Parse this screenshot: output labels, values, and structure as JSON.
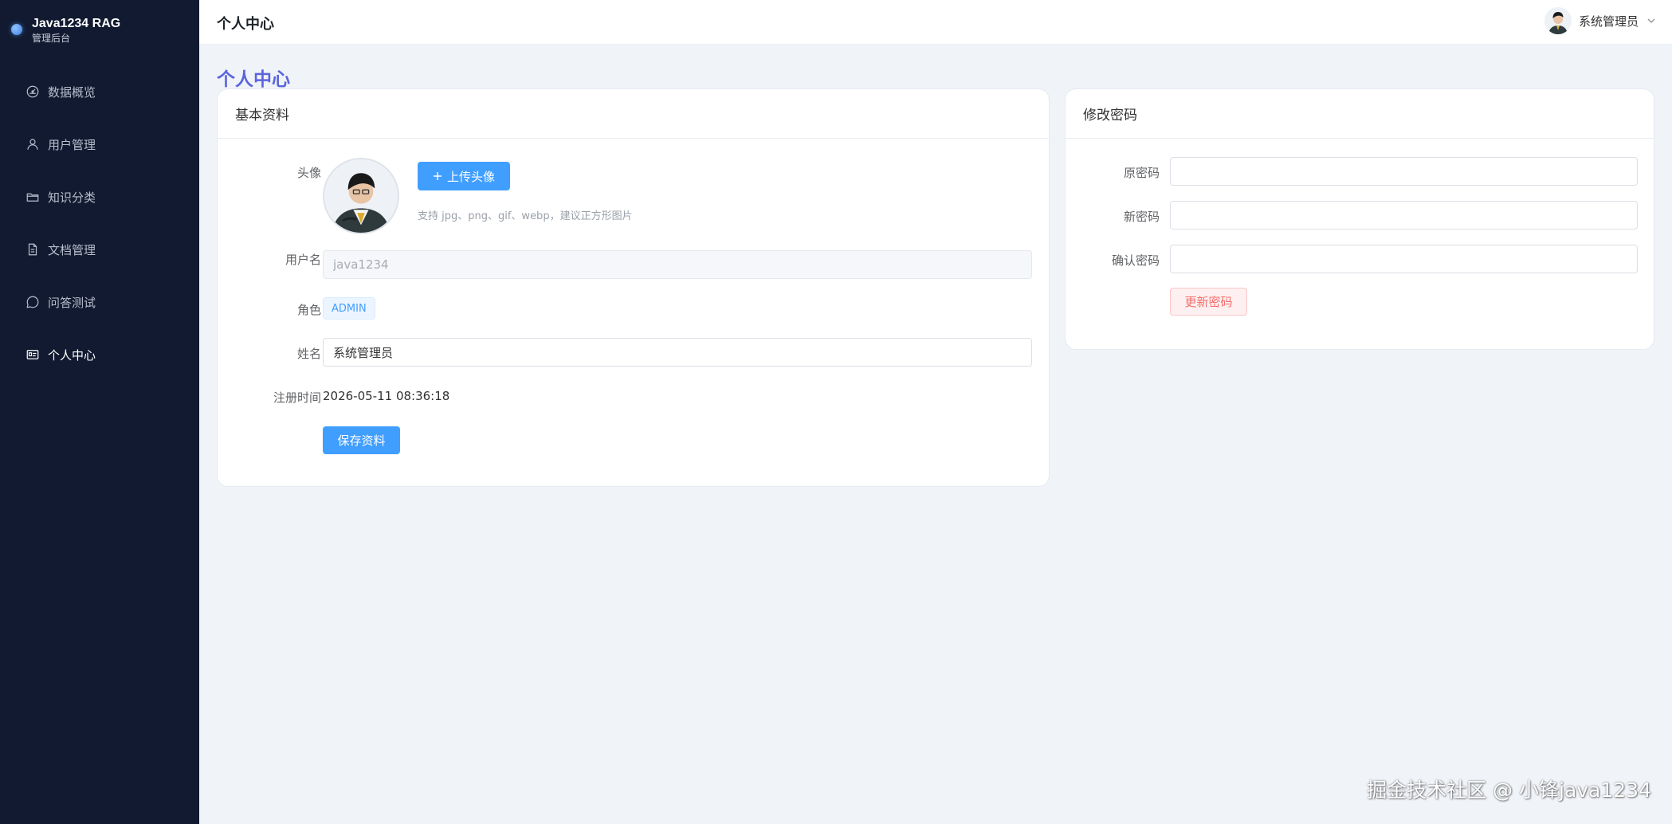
{
  "brand": {
    "title": "Java1234 RAG",
    "subtitle": "管理后台"
  },
  "sidebar": {
    "items": [
      {
        "label": "数据概览",
        "icon": "dashboard-icon"
      },
      {
        "label": "用户管理",
        "icon": "user-icon"
      },
      {
        "label": "知识分类",
        "icon": "folder-icon"
      },
      {
        "label": "文档管理",
        "icon": "document-icon"
      },
      {
        "label": "问答测试",
        "icon": "chat-icon"
      },
      {
        "label": "个人中心",
        "icon": "id-card-icon",
        "active": true
      }
    ]
  },
  "header": {
    "title": "个人中心",
    "user_name": "系统管理员"
  },
  "page": {
    "title": "个人中心"
  },
  "profile": {
    "card_title": "基本资料",
    "avatar_label": "头像",
    "upload_button": "上传头像",
    "upload_hint": "支持 jpg、png、gif、webp，建议正方形图片",
    "username_label": "用户名",
    "username_value": "java1234",
    "role_label": "角色",
    "role_value": "ADMIN",
    "name_label": "姓名",
    "name_value": "系统管理员",
    "register_label": "注册时间",
    "register_value": "2026-05-11 08:36:18",
    "save_button": "保存资料"
  },
  "password": {
    "card_title": "修改密码",
    "old_label": "原密码",
    "new_label": "新密码",
    "confirm_label": "确认密码",
    "update_button": "更新密码"
  },
  "watermark": "掘金技术社区 @ 小锋java1234",
  "colors": {
    "sidebar_bg": "#111a30",
    "primary": "#409eff",
    "page_title": "#5b65dc",
    "danger": "#f56c6c"
  }
}
